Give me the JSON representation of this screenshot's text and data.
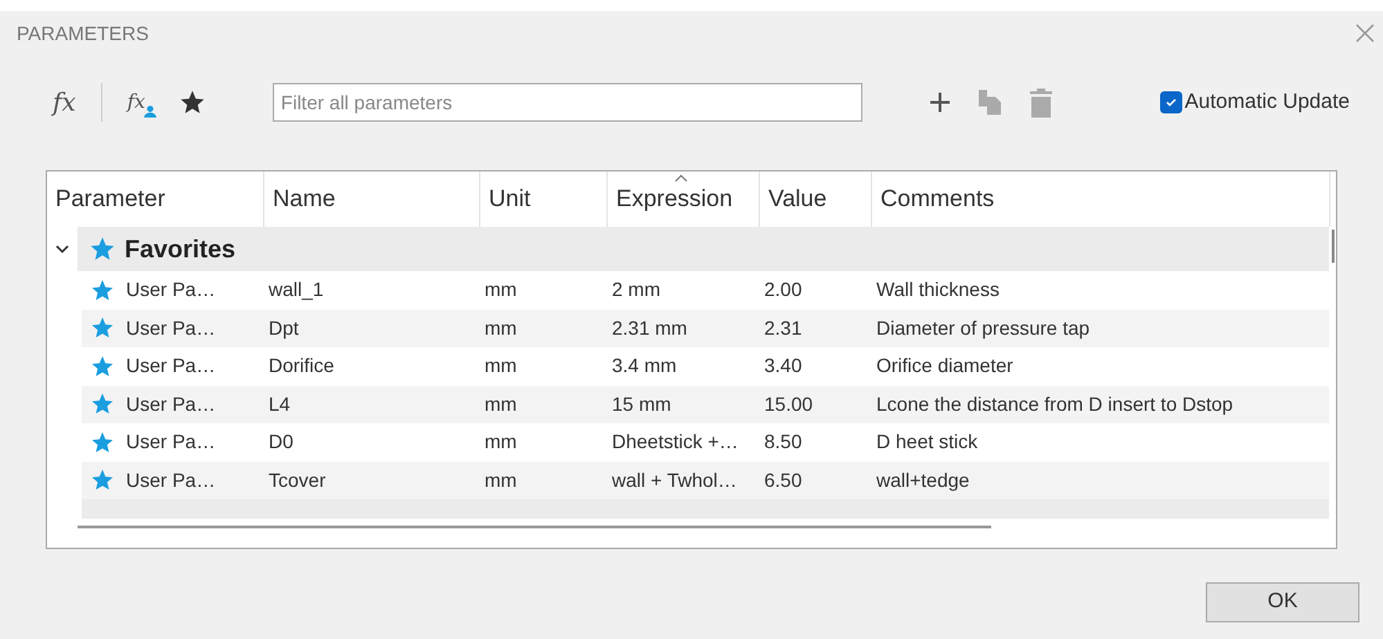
{
  "window": {
    "title": "PARAMETERS"
  },
  "toolbar": {
    "formula_glyph": "fx",
    "user_formula_glyph": "fx",
    "filter": {
      "placeholder": "Filter all parameters"
    },
    "auto_update": {
      "label": "Automatic Update",
      "checked": true
    }
  },
  "table": {
    "columns": [
      "Parameter",
      "Name",
      "Unit",
      "Expression",
      "Value",
      "Comments"
    ],
    "group": {
      "label": "Favorites",
      "expanded": true
    },
    "rows": [
      {
        "parameter": "User Pa…",
        "name": "wall_1",
        "unit": "mm",
        "expression": "2 mm",
        "value": "2.00",
        "comment": "Wall thickness",
        "favorite": true
      },
      {
        "parameter": "User Pa…",
        "name": "Dpt",
        "unit": "mm",
        "expression": "2.31 mm",
        "value": "2.31",
        "comment": "Diameter of pressure tap",
        "favorite": true
      },
      {
        "parameter": "User Pa…",
        "name": "Dorifice",
        "unit": "mm",
        "expression": "3.4 mm",
        "value": "3.40",
        "comment": "Orifice diameter",
        "favorite": true
      },
      {
        "parameter": "User Pa…",
        "name": "L4",
        "unit": "mm",
        "expression": "15 mm",
        "value": "15.00",
        "comment": "Lcone the distance from D insert to Dstop",
        "favorite": true
      },
      {
        "parameter": "User Pa…",
        "name": "D0",
        "unit": "mm",
        "expression": "Dheetstick +…",
        "value": "8.50",
        "comment": "D heet stick",
        "favorite": true
      },
      {
        "parameter": "User Pa…",
        "name": "Tcover",
        "unit": "mm",
        "expression": "wall + Twhol…",
        "value": "6.50",
        "comment": "wall+tedge",
        "favorite": true
      }
    ]
  },
  "buttons": {
    "ok": "OK"
  }
}
